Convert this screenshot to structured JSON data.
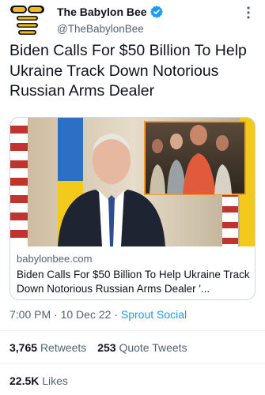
{
  "author": {
    "display_name": "The Babylon Bee",
    "handle": "@TheBabylonBee"
  },
  "tweet": {
    "text": "Biden Calls For $50 Billion To Help Ukraine Track Down Notorious Russian Arms Dealer"
  },
  "card": {
    "domain": "babylonbee.com",
    "title": "Biden Calls For $50 Billion To Help Ukraine Track Down Notorious Russian Arms Dealer '..."
  },
  "meta": {
    "time": "7:00 PM",
    "separator1": "·",
    "date": "10 Dec 22",
    "separator2": "·",
    "source": "Sprout Social"
  },
  "stats": {
    "retweets_count": "3,765",
    "retweets_label": "Retweets",
    "quotes_count": "253",
    "quotes_label": "Quote Tweets",
    "likes_count": "22.5K",
    "likes_label": "Likes"
  },
  "colors": {
    "accent": "#1d9bf0",
    "text": "#0f1419",
    "secondary": "#536471",
    "brand_yellow": "#f6b91c"
  },
  "icons": {
    "avatar": "babylon-bee-logo-icon",
    "verified": "verified-badge-icon",
    "more": "more-dots-icon"
  }
}
